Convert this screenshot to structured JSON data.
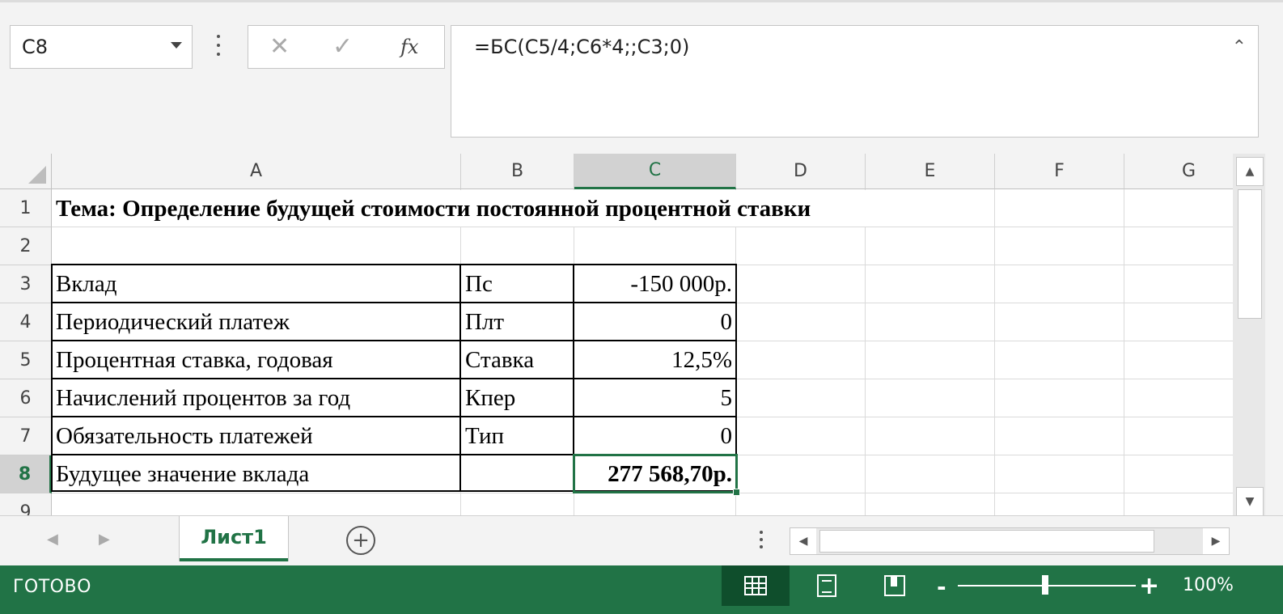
{
  "formula_bar": {
    "name_box": "C8",
    "cancel_icon": "✕",
    "enter_icon": "✓",
    "fx_label": "fx",
    "formula": "=БС(C5/4;C6*4;;C3;0)"
  },
  "columns": [
    "A",
    "B",
    "C",
    "D",
    "E",
    "F",
    "G"
  ],
  "selected_column": "C",
  "rows": [
    "1",
    "2",
    "3",
    "4",
    "5",
    "6",
    "7",
    "8",
    "9"
  ],
  "selected_row": "8",
  "cells": {
    "A1": "Тема: Определение будущей стоимости постоянной процентной ставки",
    "A3": "Вклад",
    "B3": "Пс",
    "C3": "-150 000р.",
    "A4": "Периодический платеж",
    "B4": "Плт",
    "C4": "0",
    "A5": "Процентная ставка, годовая",
    "B5": "Ставка",
    "C5": "12,5%",
    "A6": "Начислений процентов за год",
    "B6": "Кпер",
    "C6": "5",
    "A7": "Обязательность платежей",
    "B7": "Тип",
    "C7": "0",
    "A8": "Будущее значение вклада",
    "C8": "277 568,70р."
  },
  "sheet_tabs": {
    "active": "Лист1",
    "add_icon": "+"
  },
  "status_bar": {
    "mode": "ГОТОВО",
    "zoom": "100%",
    "zoom_level": 100,
    "active_view": "normal"
  },
  "icons": {
    "name_box_dropdown": "chevron-down-icon",
    "formula_collapse": "chevron-up-icon",
    "views": [
      "normal-view-icon",
      "page-layout-icon",
      "page-break-icon"
    ]
  },
  "colors": {
    "accent": "#217346",
    "status_bg": "#217346"
  }
}
